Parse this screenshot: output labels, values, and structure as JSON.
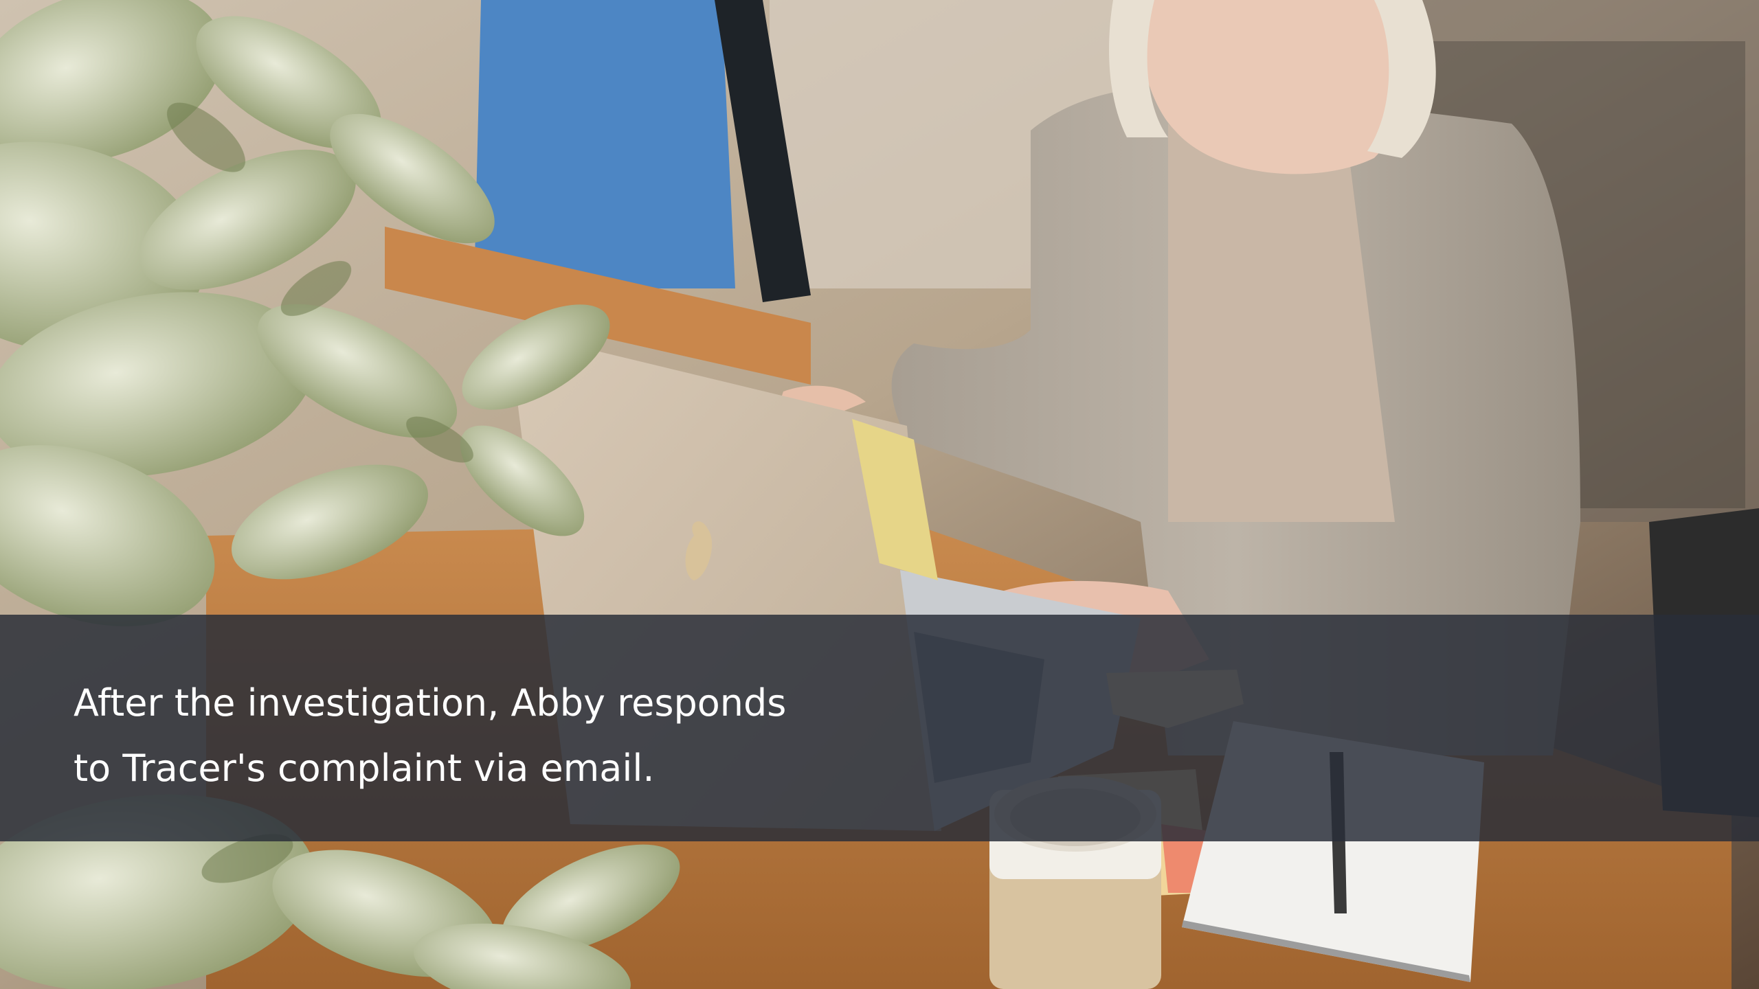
{
  "slide": {
    "caption_lines": [
      "After the investigation, Abby responds",
      "to Tracer's complaint via email."
    ]
  },
  "photo": {
    "subject": "woman-typing-on-laptop",
    "objects": [
      "plant-icon",
      "laptop-icon",
      "mug-icon",
      "notebook-icon",
      "pen-icon",
      "sticky-note-icon"
    ]
  },
  "colors": {
    "overlay": "#282d38",
    "caption_text": "#ffffff"
  }
}
